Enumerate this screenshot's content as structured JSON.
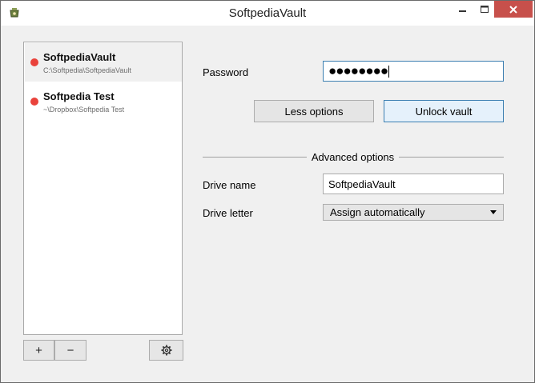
{
  "window": {
    "title": "SoftpediaVault"
  },
  "vaults": [
    {
      "name": "SoftpediaVault",
      "path": "C:\\Softpedia\\SoftpediaVault",
      "status_color": "#e9423b",
      "selected": true
    },
    {
      "name": "Softpedia Test",
      "path": "~\\Dropbox\\Softpedia Test",
      "status_color": "#e9423b",
      "selected": false
    }
  ],
  "toolbar": {
    "add_label": "+",
    "remove_label": "−",
    "settings_icon": "gear-icon"
  },
  "unlock": {
    "password_label": "Password",
    "password_value": "●●●●●●●●",
    "less_options_label": "Less options",
    "unlock_label": "Unlock vault"
  },
  "advanced": {
    "heading": "Advanced options",
    "drive_name_label": "Drive name",
    "drive_name_value": "SoftpediaVault",
    "drive_letter_label": "Drive letter",
    "drive_letter_value": "Assign automatically"
  },
  "colors": {
    "accent": "#3c7fb1",
    "close_button": "#c7504b",
    "status_red": "#e9423b"
  }
}
